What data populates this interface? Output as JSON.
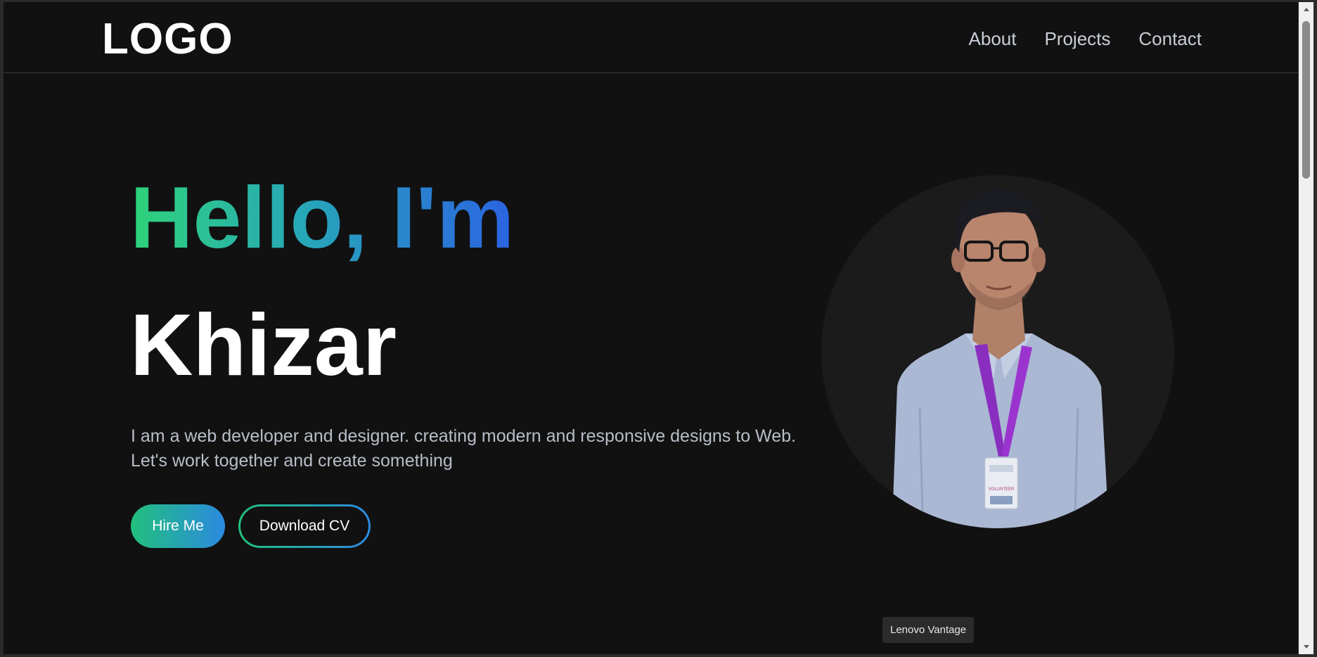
{
  "header": {
    "logo": "LOGO",
    "nav": [
      "About",
      "Projects",
      "Contact"
    ]
  },
  "hero": {
    "greeting": "Hello, I'm",
    "name": "Khizar",
    "description": "I am a web developer and designer. creating modern and responsive designs to Web. Let's work together and create something",
    "hire_label": "Hire Me",
    "cv_label": "Download CV",
    "photo_badge": "VOLUNTEER"
  },
  "tooltip": "Lenovo Vantage",
  "colors": {
    "background": "#111111",
    "gradient_start": "#2fd47a",
    "gradient_end": "#2b63e3",
    "text_muted": "#b8bec8"
  },
  "icons": [
    "chevron-up-icon",
    "chevron-down-icon"
  ]
}
